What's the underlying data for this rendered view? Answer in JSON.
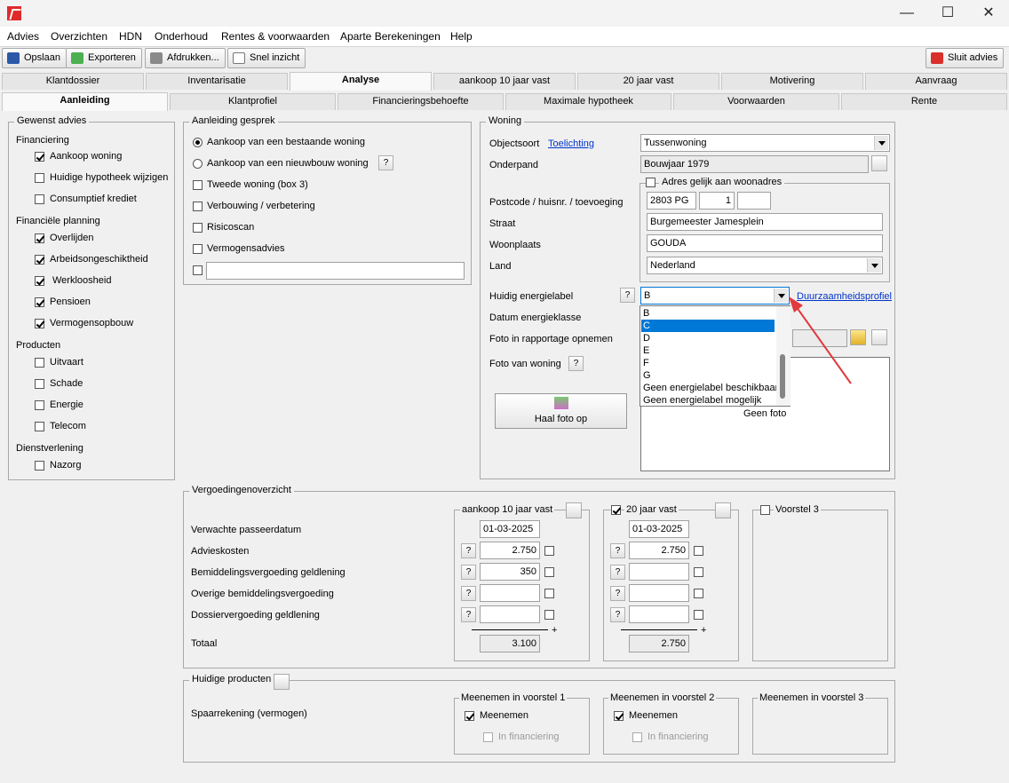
{
  "window": {
    "minimize": "—",
    "maximize": "☐",
    "close": "✕"
  },
  "menu": [
    "Advies",
    "Overzichten",
    "HDN",
    "Onderhoud",
    "Rentes & voorwaarden",
    "Aparte Berekeningen",
    "Help"
  ],
  "toolbar": {
    "save": "Opslaan",
    "export": "Exporteren",
    "print": "Afdrukken...",
    "quick": "Snel inzicht",
    "close_advice": "Sluit advies"
  },
  "tabs_main": [
    "Klantdossier",
    "Inventarisatie",
    "Analyse",
    "aankoop 10 jaar vast",
    "20 jaar vast",
    "Motivering",
    "Aanvraag"
  ],
  "tabs_sub": [
    "Aanleiding",
    "Klantprofiel",
    "Financieringsbehoefte",
    "Maximale hypotheek",
    "Voorwaarden",
    "Rente"
  ],
  "gewenst": {
    "title": "Gewenst advies",
    "financiering": "Financiering",
    "aankoop": "Aankoop woning",
    "hypotheek_wijzigen": "Huidige hypotheek wijzigen",
    "consumptief": "Consumptief krediet",
    "planning": "Financiële planning",
    "overlijden": "Overlijden",
    "arbeid": "Arbeidsongeschiktheid",
    "werkloosheid": "Werkloosheid",
    "pensioen": "Pensioen",
    "vermogensopbouw": "Vermogensopbouw",
    "producten": "Producten",
    "uitvaart": "Uitvaart",
    "schade": "Schade",
    "energie": "Energie",
    "telecom": "Telecom",
    "dienst": "Dienstverlening",
    "nazorg": "Nazorg"
  },
  "aanleiding": {
    "title": "Aanleiding gesprek",
    "bestaand": "Aankoop van een bestaande woning",
    "nieuwbouw": "Aankoop van een nieuwbouw woning",
    "tweede": "Tweede woning (box 3)",
    "verbouwing": "Verbouwing / verbetering",
    "risicoscan": "Risicoscan",
    "vermogensadvies": "Vermogensadvies",
    "overig": ""
  },
  "woning": {
    "title": "Woning",
    "objectsoort_label": "Objectsoort",
    "toelichting": "Toelichting",
    "objectsoort": "Tussenwoning",
    "onderpand_label": "Onderpand",
    "onderpand": "Bouwjaar 1979",
    "adres_gelijk": "Adres gelijk aan woonadres",
    "postcode_label": "Postcode / huisnr. / toevoeging",
    "postcode": "2803 PG",
    "huisnr": "1",
    "toevoeging": "",
    "straat_label": "Straat",
    "straat": "Burgemeester Jamesplein",
    "woonplaats_label": "Woonplaats",
    "woonplaats": "GOUDA",
    "land_label": "Land",
    "land": "Nederland",
    "energielabel_label": "Huidig energielabel",
    "energielabel": "B",
    "duurzaam": "Duurzaamheidsprofiel",
    "datum_label": "Datum energieklasse",
    "foto_rapportage_label": "Foto in rapportage opnemen",
    "foto_woning_label": "Foto van woning",
    "haal_foto": "Haal foto op",
    "geen_foto": "Geen foto",
    "options": [
      "B",
      "C",
      "D",
      "E",
      "F",
      "G",
      "Geen energielabel beschikbaar",
      "Geen energielabel mogelijk"
    ]
  },
  "vergoeding": {
    "title": "Vergoedingenoverzicht",
    "col1": "aankoop 10 jaar vast",
    "col2": "20 jaar vast",
    "col3": "Voorstel 3",
    "rows": [
      "Verwachte passeerdatum",
      "Advieskosten",
      "Bemiddelingsvergoeding geldlening",
      "Overige bemiddelingsvergoeding",
      "Dossiervergoeding geldlening",
      "Totaal"
    ],
    "v1": {
      "datum": "01-03-2025",
      "advies": "2.750",
      "bemiddeling": "350",
      "overige": "",
      "dossier": "",
      "totaal": "3.100"
    },
    "v2": {
      "datum": "01-03-2025",
      "advies": "2.750",
      "bemiddeling": "",
      "overige": "",
      "dossier": "",
      "totaal": "2.750"
    },
    "plus": "+"
  },
  "huidig": {
    "title": "Huidige producten",
    "spaar": "Spaarrekening (vermogen)",
    "m1": "Meenemen in voorstel 1",
    "m2": "Meenemen in voorstel 2",
    "m3": "Meenemen in voorstel 3",
    "meenemen": "Meenemen",
    "in_fin": "In financiering"
  },
  "colors": {
    "accent": "#0078d7",
    "arrow": "#e0393e"
  }
}
